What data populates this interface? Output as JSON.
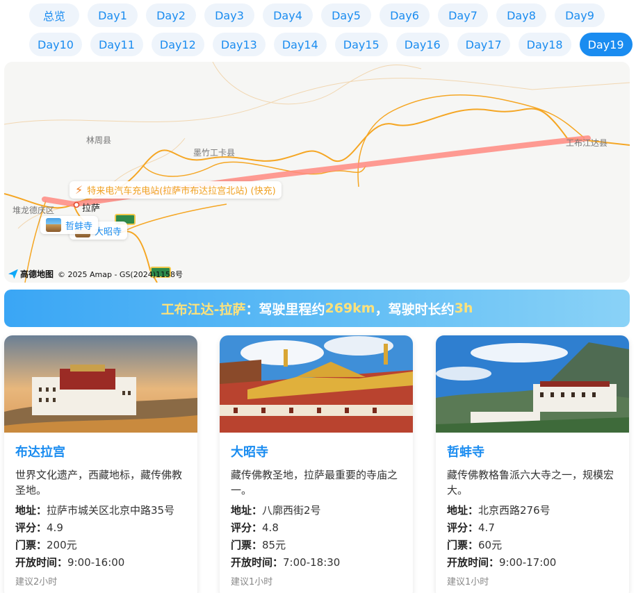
{
  "tabs": {
    "row1": [
      "总览",
      "Day1",
      "Day2",
      "Day3",
      "Day4",
      "Day5",
      "Day6",
      "Day7",
      "Day8",
      "Day9"
    ],
    "row2": [
      "Day10",
      "Day11",
      "Day12",
      "Day13",
      "Day14",
      "Day15",
      "Day16",
      "Day17",
      "Day18",
      "Day19"
    ],
    "active": "Day19"
  },
  "map": {
    "places": {
      "linzhou": "林周县",
      "mozhugongka": "墨竹工卡县",
      "gongbujiangda": "工布江达县",
      "duilongdeqing": "堆龙德庆区",
      "lasa": "拉萨"
    },
    "charger_poi": "特来电汽车充电站(拉萨市布达拉宫北站) (快充)",
    "poi_zhebang": "哲蚌寺",
    "poi_dazhao": "大昭寺",
    "logo": "高德地图",
    "copyright": "© 2025 Amap - GS(2024)1158号",
    "route_color": "#ff8a80",
    "road_color": "#f5a623"
  },
  "banner": {
    "route": "工布江达-拉萨",
    "text1": "：驾驶里程约",
    "distance": "269km",
    "text2": "，驾驶时长约",
    "duration": "3h"
  },
  "attractions": [
    {
      "name": "布达拉宫",
      "desc": "世界文化遗产，西藏地标，藏传佛教圣地。",
      "address_label": "地址：",
      "address": "拉萨市城关区北京中路35号",
      "rating_label": "评分：",
      "rating": "4.9",
      "ticket_label": "门票：",
      "ticket": "200元",
      "hours_label": "开放时间：",
      "hours": "9:00-16:00",
      "suggest": "建议2小时"
    },
    {
      "name": "大昭寺",
      "desc": "藏传佛教圣地，拉萨最重要的寺庙之一。",
      "address_label": "地址：",
      "address": "八廓西街2号",
      "rating_label": "评分：",
      "rating": "4.8",
      "ticket_label": "门票：",
      "ticket": "85元",
      "hours_label": "开放时间：",
      "hours": "7:00-18:30",
      "suggest": "建议1小时"
    },
    {
      "name": "哲蚌寺",
      "desc": "藏传佛教格鲁派六大寺之一，规模宏大。",
      "address_label": "地址：",
      "address": "北京西路276号",
      "rating_label": "评分：",
      "rating": "4.7",
      "ticket_label": "门票：",
      "ticket": "60元",
      "hours_label": "开放时间：",
      "hours": "9:00-17:00",
      "suggest": "建议1小时"
    }
  ]
}
